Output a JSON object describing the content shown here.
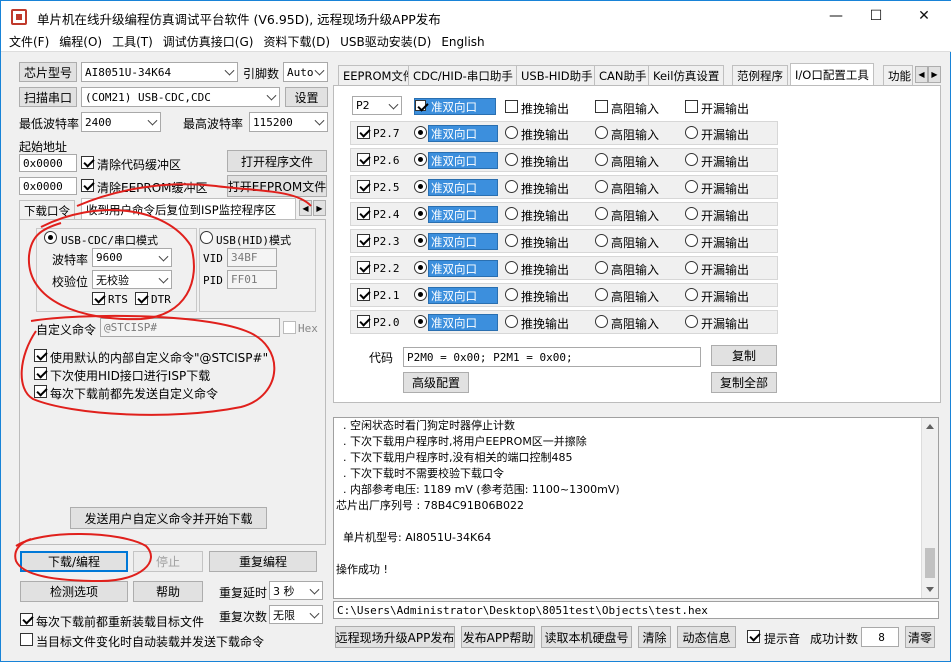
{
  "window": {
    "title": "单片机在线升级编程仿真调试平台软件 (V6.95D), 远程现场升级APP发布",
    "minimize": "—",
    "maximize": "☐",
    "close": "✕"
  },
  "menu": [
    "文件(F)",
    "编程(O)",
    "工具(T)",
    "调试仿真接口(G)",
    "资料下载(D)",
    "USB驱动安装(D)",
    "English"
  ],
  "left": {
    "chip_model_btn": "芯片型号",
    "chip_model": "AI8051U-34K64",
    "pin_label": "引脚数",
    "pin_value": "Auto",
    "scan_port_btn": "扫描串口",
    "port_value": "(COM21) USB-CDC,CDC",
    "settings_btn": "设置",
    "min_baud_label": "最低波特率",
    "min_baud": "2400",
    "max_baud_label": "最高波特率",
    "max_baud": "115200",
    "start_addr_label": "起始地址",
    "addr1": "0x0000",
    "clear_code": "清除代码缓冲区",
    "open_prog_btn": "打开程序文件",
    "addr2": "0x0000",
    "clear_eeprom": "清除EEPROM缓冲区",
    "open_eeprom_btn": "打开EEPROM文件",
    "tab_download": "下载口令",
    "tab_reset": "收到用户命令后复位到ISP监控程序区",
    "usb_cdc_mode": "USB-CDC/串口模式",
    "usb_hid_mode": "USB(HID)模式",
    "baud_label": "波特率",
    "baud_value": "9600",
    "parity_label": "校验位",
    "parity_value": "无校验",
    "rts": "RTS",
    "dtr": "DTR",
    "vid_label": "VID",
    "vid_value": "34BF",
    "pid_label": "PID",
    "pid_value": "FF01",
    "custom_cmd_label": "自定义命令",
    "custom_cmd_value": "@STCISP#",
    "hex_label": "Hex",
    "opt1": "使用默认的内部自定义命令\"@STCISP#\"",
    "opt2": "下次使用HID接口进行ISP下载",
    "opt3": "每次下载前都先发送自定义命令",
    "send_cmd_btn": "发送用户自定义命令并开始下载",
    "download_btn": "下载/编程",
    "stop_btn": "停止",
    "repeat_btn": "重复编程",
    "check_btn": "检测选项",
    "help_btn": "帮助",
    "delay_label": "重复延时",
    "delay_value": "3 秒",
    "count_label": "重复次数",
    "count_value": "无限",
    "reload": "每次下载前都重新装载目标文件",
    "autoload": "当目标文件变化时自动装载并发送下载命令"
  },
  "tabs": [
    "EEPROM文件",
    "CDC/HID-串口助手",
    "USB-HID助手",
    "CAN助手",
    "Keil仿真设置",
    "范例程序",
    "I/O口配置工具",
    "功能"
  ],
  "io": {
    "port_select": "P2",
    "modes": [
      "准双向口",
      "推挽输出",
      "高阻输入",
      "开漏输出"
    ],
    "pins": [
      "P2.7",
      "P2.6",
      "P2.5",
      "P2.4",
      "P2.3",
      "P2.2",
      "P2.1",
      "P2.0"
    ],
    "code_label": "代码",
    "code_value": "P2M0 = 0x00; P2M1 = 0x00;",
    "copy_btn": "复制",
    "advanced_btn": "高级配置",
    "copy_all_btn": "复制全部"
  },
  "log": [
    "  . 空闲状态时看门狗定时器停止计数",
    "  . 下次下载用户程序时,将用户EEPROM区一并擦除",
    "  . 下次下载用户程序时,没有相关的端口控制485",
    "  . 下次下载时不需要校验下载口令",
    "  . 内部参考电压: 1189 mV (参考范围: 1100~1300mV)",
    "芯片出厂序列号 : 78B4C91B06B022",
    "",
    "  单片机型号: AI8051U-34K64",
    "",
    "操作成功 !"
  ],
  "path": "C:\\Users\\Administrator\\Desktop\\8051test\\Objects\\test.hex",
  "bottom": {
    "remote_btn": "远程现场升级APP发布",
    "publish_help_btn": "发布APP帮助",
    "read_id_btn": "读取本机硬盘号",
    "clear_btn": "清除",
    "anim_btn": "动态信息",
    "beep": "提示音",
    "success_label": "成功计数",
    "success_count": "8",
    "reset_btn": "清零"
  },
  "colors": {
    "accent": "#3c8fdd",
    "annotation": "#e0201c"
  }
}
